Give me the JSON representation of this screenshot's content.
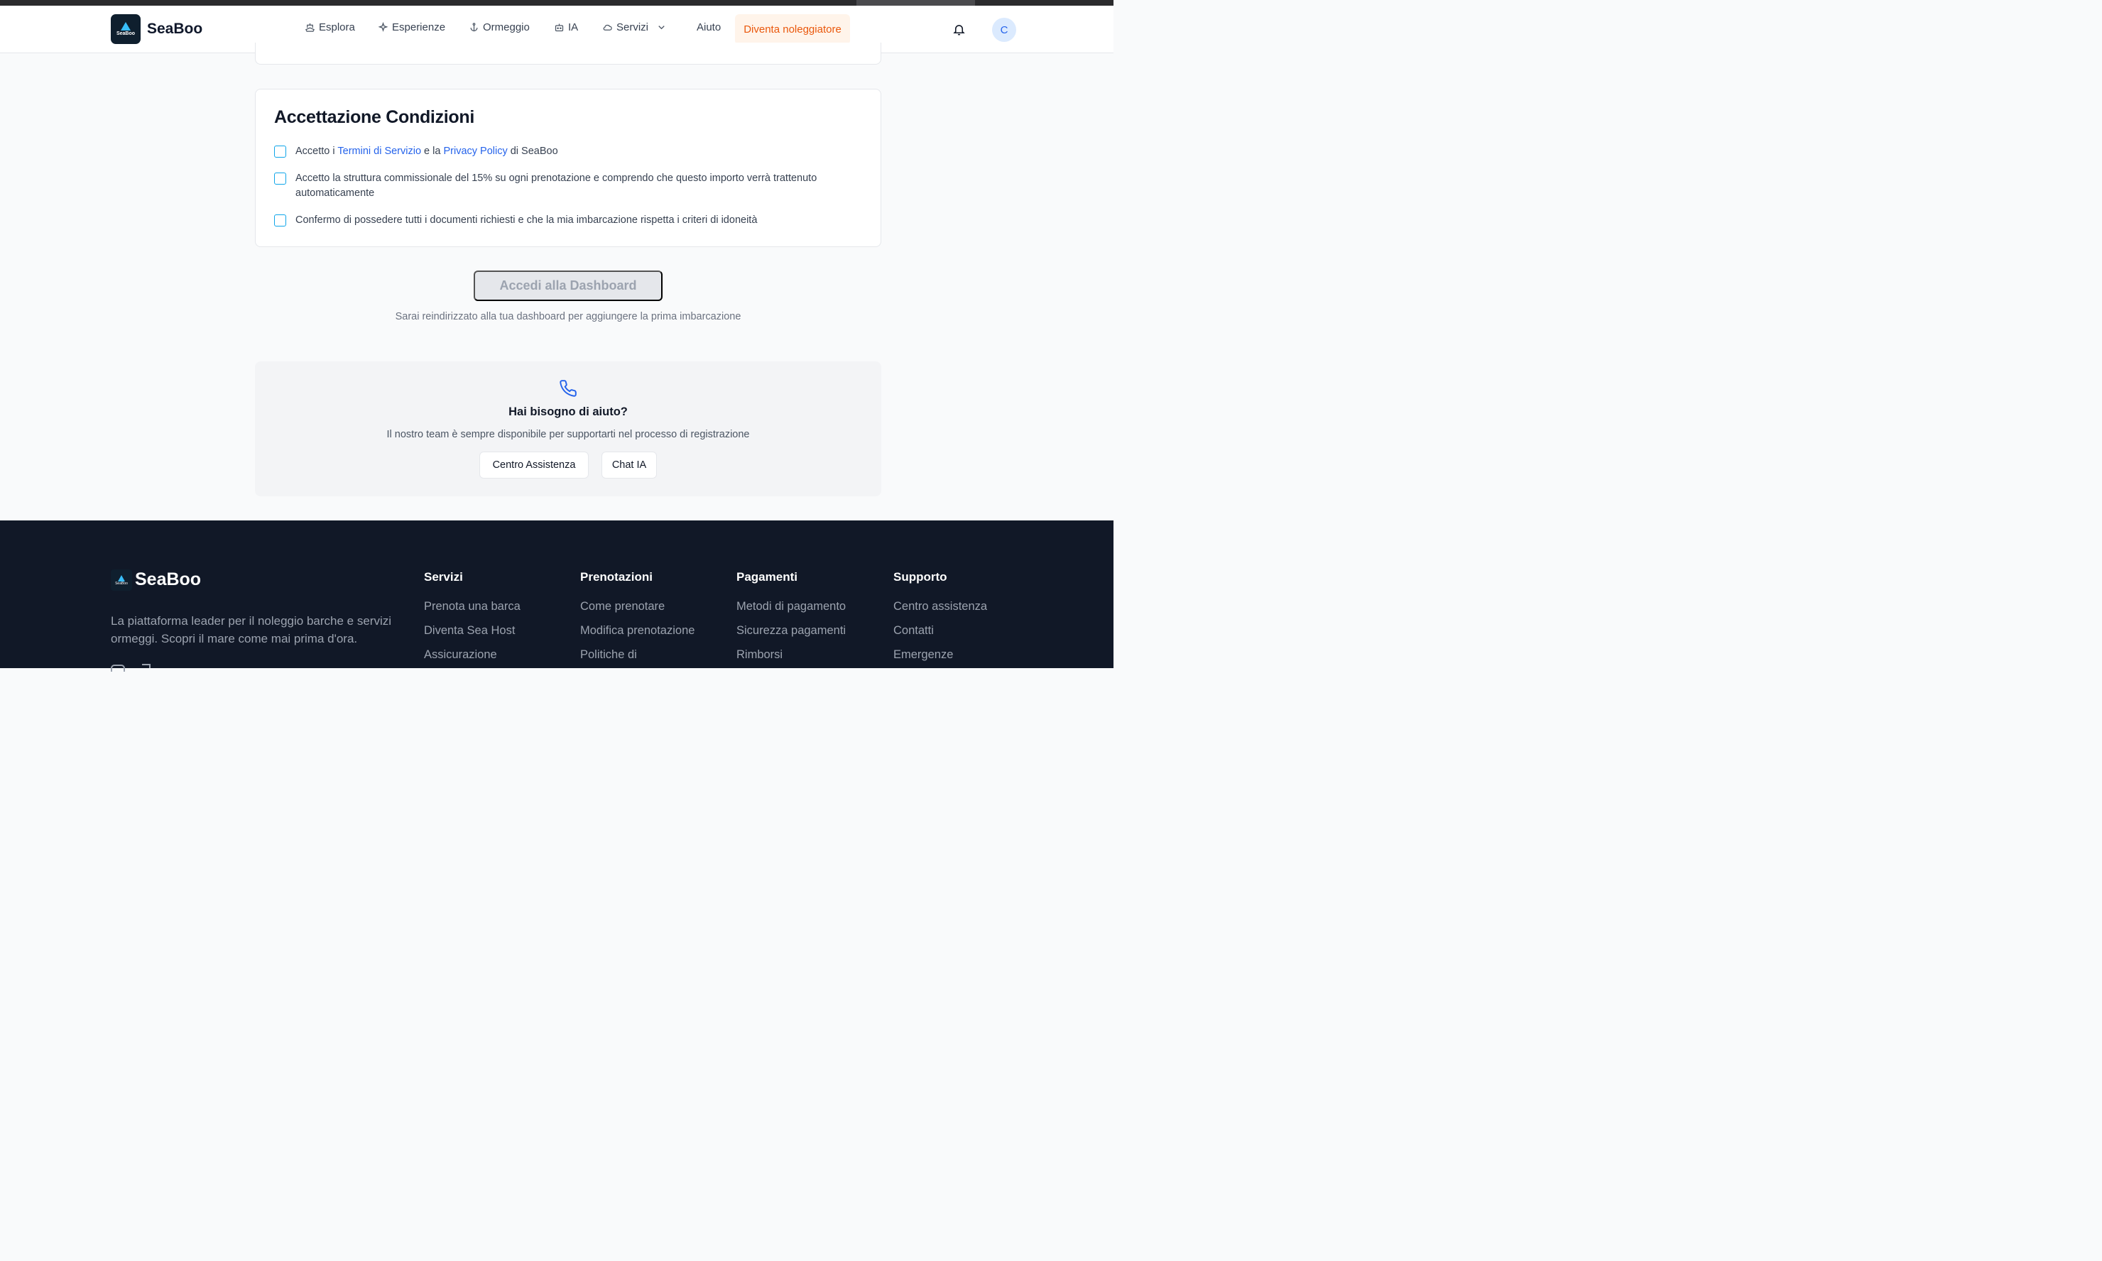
{
  "nav": {
    "brand": "SeaBoo",
    "logo_mini": "SeaBoo",
    "items": [
      {
        "label": "Esplora",
        "icon": "ship-icon"
      },
      {
        "label": "Esperienze",
        "icon": "sparkles-icon"
      },
      {
        "label": "Ormeggio",
        "icon": "anchor-icon"
      },
      {
        "label": "IA",
        "icon": "robot-icon"
      },
      {
        "label": "Servizi",
        "icon": "cloud-icon"
      },
      {
        "label": "Aiuto",
        "icon": ""
      }
    ],
    "cta": "Diventa noleggiatore",
    "avatar_initial": "C"
  },
  "terms": {
    "title": "Accettazione Condizioni",
    "item1": {
      "prefix": "Accetto i ",
      "link1": "Termini di Servizio",
      "middle": " e la ",
      "link2": "Privacy Policy",
      "suffix": " di SeaBoo"
    },
    "item2": "Accetto la struttura commissionale del 15% su ogni prenotazione e comprendo che questo importo verrà trattenuto automaticamente",
    "item3": "Confermo di possedere tutti i documenti richiesti e che la mia imbarcazione rispetta i criteri di idoneità"
  },
  "dashboard": {
    "button": "Accedi alla Dashboard",
    "note": "Sarai reindirizzato alla tua dashboard per aggiungere la prima imbarcazione"
  },
  "help": {
    "title": "Hai bisogno di aiuto?",
    "subtitle": "Il nostro team è sempre disponibile per supportarti nel processo di registrazione",
    "btn_center": "Centro Assistenza",
    "btn_chat": "Chat IA"
  },
  "footer": {
    "brand": "SeaBoo",
    "logo_mini": "SeaBoo",
    "description": "La piattaforma leader per il noleggio barche e servizi ormeggi. Scopri il mare come mai prima d'ora.",
    "columns": [
      {
        "title": "Servizi",
        "links": [
          "Prenota una barca",
          "Diventa Sea Host",
          "Assicurazione"
        ]
      },
      {
        "title": "Prenotazioni",
        "links": [
          "Come prenotare",
          "Modifica prenotazione",
          "Politiche di"
        ]
      },
      {
        "title": "Pagamenti",
        "links": [
          "Metodi di pagamento",
          "Sicurezza pagamenti",
          "Rimborsi"
        ]
      },
      {
        "title": "Supporto",
        "links": [
          "Centro assistenza",
          "Contatti",
          "Emergenze"
        ]
      }
    ]
  }
}
